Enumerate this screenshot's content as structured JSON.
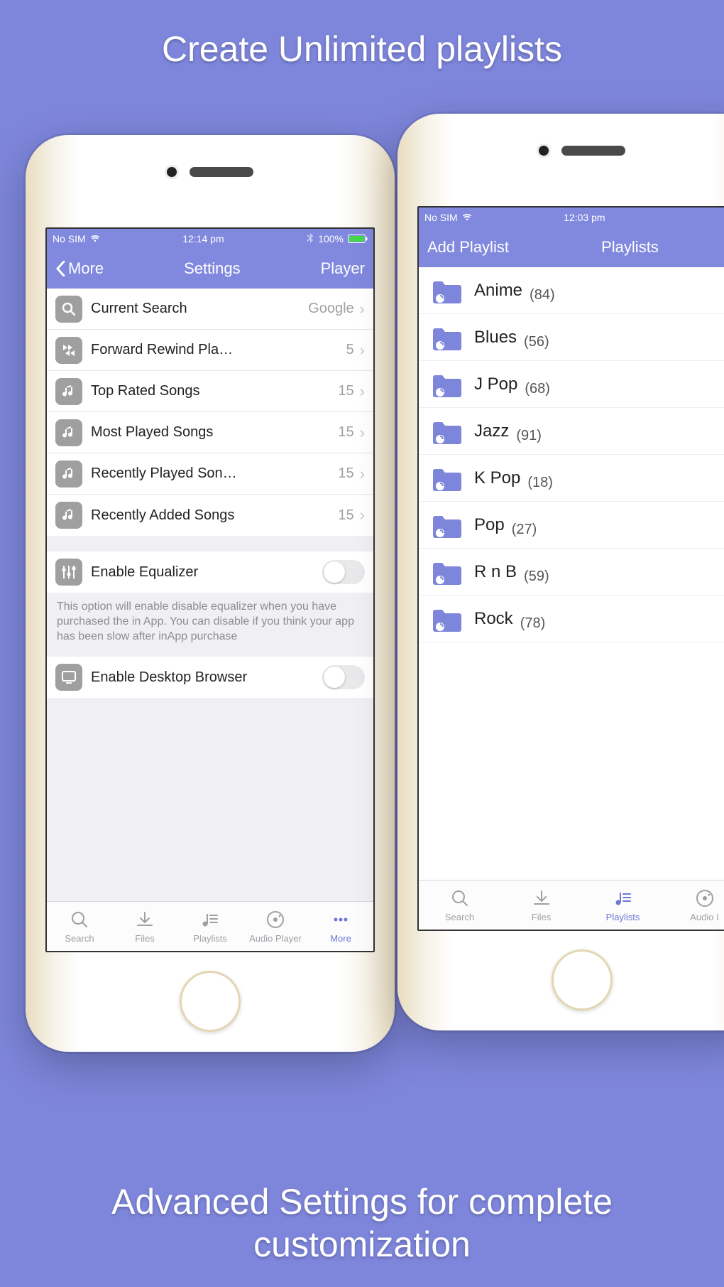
{
  "promo": {
    "title": "Create Unlimited playlists",
    "footer": "Advanced Settings for complete\ncustomization"
  },
  "left": {
    "status": {
      "carrier": "No SIM",
      "time": "12:14 pm",
      "battery": "100%"
    },
    "nav": {
      "back": "More",
      "title": "Settings",
      "right": "Player"
    },
    "settings": [
      {
        "icon": "search",
        "label": "Current Search",
        "value": "Google"
      },
      {
        "icon": "fwdrwd",
        "label": "Forward Rewind Pla…",
        "value": "5"
      },
      {
        "icon": "music",
        "label": "Top Rated Songs",
        "value": "15"
      },
      {
        "icon": "music",
        "label": "Most Played Songs",
        "value": "15"
      },
      {
        "icon": "music",
        "label": "Recently Played Son…",
        "value": "15"
      },
      {
        "icon": "music",
        "label": "Recently Added Songs",
        "value": "15"
      }
    ],
    "equalizer": {
      "label": "Enable Equalizer"
    },
    "equalizer_footer": "This option will enable disable equalizer when you have purchased the in App. You can disable if you think your app has been slow after inApp purchase",
    "desktop": {
      "label": "Enable Desktop Browser"
    },
    "tabs": [
      {
        "id": "search",
        "label": "Search"
      },
      {
        "id": "files",
        "label": "Files"
      },
      {
        "id": "playlists",
        "label": "Playlists"
      },
      {
        "id": "audio",
        "label": "Audio Player"
      },
      {
        "id": "more",
        "label": "More",
        "active": true
      }
    ]
  },
  "right": {
    "status": {
      "carrier": "No SIM",
      "time": "12:03 pm"
    },
    "nav": {
      "left": "Add Playlist",
      "title": "Playlists"
    },
    "playlists": [
      {
        "name": "Anime",
        "count": 84
      },
      {
        "name": "Blues",
        "count": 56
      },
      {
        "name": "J Pop",
        "count": 68
      },
      {
        "name": "Jazz",
        "count": 91
      },
      {
        "name": "K Pop",
        "count": 18
      },
      {
        "name": "Pop",
        "count": 27
      },
      {
        "name": "R n B",
        "count": 59
      },
      {
        "name": "Rock",
        "count": 78
      }
    ],
    "tabs": [
      {
        "id": "search",
        "label": "Search"
      },
      {
        "id": "files",
        "label": "Files"
      },
      {
        "id": "playlists",
        "label": "Playlists",
        "active": true
      },
      {
        "id": "audio",
        "label": "Audio I"
      }
    ]
  }
}
